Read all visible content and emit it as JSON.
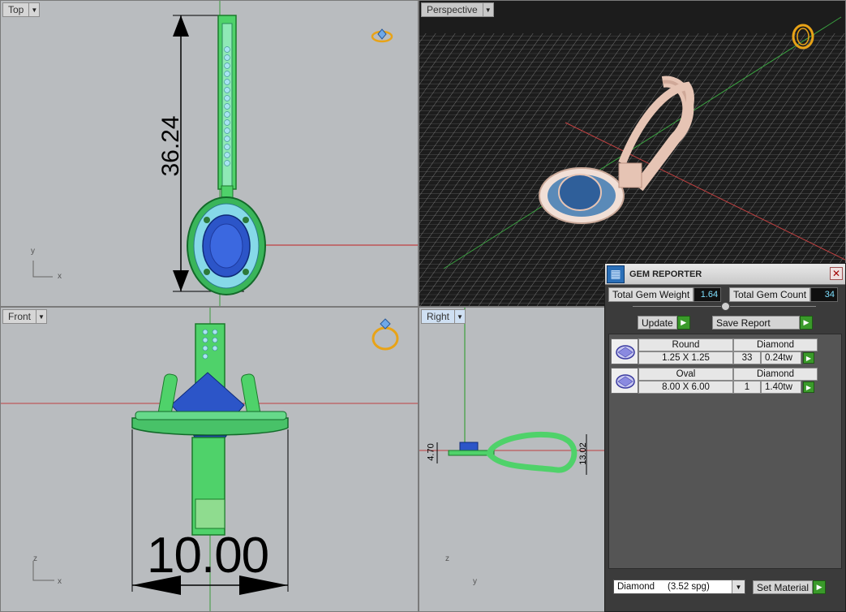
{
  "viewports": {
    "top": {
      "label": "Top",
      "dimension": "36.24",
      "axis_y": "y",
      "axis_x": "x"
    },
    "perspective": {
      "label": "Perspective"
    },
    "front": {
      "label": "Front",
      "dimension": "10.00",
      "axis_y": "z",
      "axis_x": "x"
    },
    "right": {
      "label": "Right",
      "dim_height": "4.70",
      "dim_width": "13.02",
      "axis_y": "z",
      "axis_x": "y"
    }
  },
  "gem_reporter": {
    "title": "GEM REPORTER",
    "close_icon": "close-icon",
    "total_weight_label": "Total Gem Weight",
    "total_weight_value": "1.64",
    "total_count_label": "Total Gem Count",
    "total_count_value": "34",
    "update_label": "Update",
    "save_report_label": "Save Report",
    "gems": [
      {
        "shape": "Round",
        "material": "Diamond",
        "size": "1.25 X 1.25",
        "count": "33",
        "weight": "0.24tw"
      },
      {
        "shape": "Oval",
        "material": "Diamond",
        "size": "8.00 X 6.00",
        "count": "1",
        "weight": "1.40tw"
      }
    ],
    "material_selected": "Diamond     (3.52 spg)",
    "set_material_label": "Set Material"
  },
  "colors": {
    "ring_green": "#3fcf5a",
    "gem_blue": "#2c55c8",
    "metal_rose": "#e6c4b4",
    "icon_gold": "#e8a317",
    "axis_red": "#c04040"
  }
}
